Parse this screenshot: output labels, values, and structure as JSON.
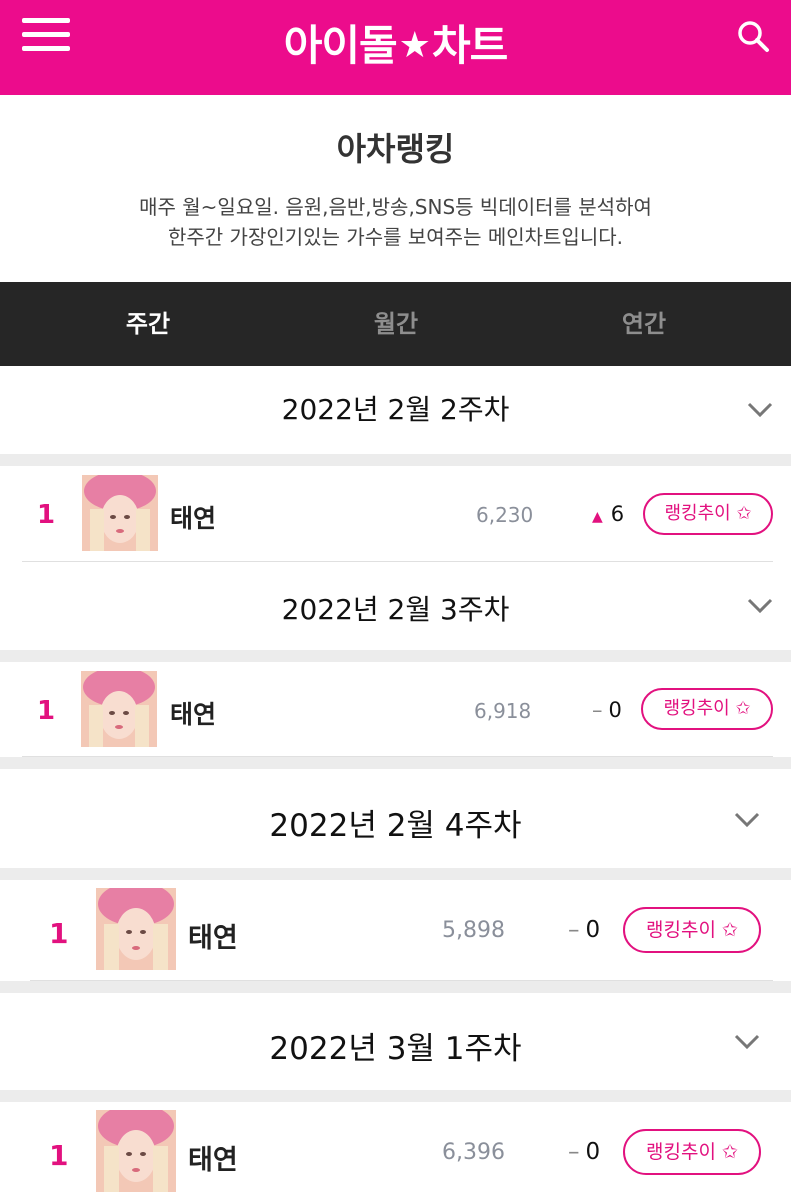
{
  "header": {
    "logo_left": "아이돌",
    "logo_star": "★",
    "logo_right": "차트",
    "menu_icon": "hamburger-menu-icon",
    "search_icon": "search-icon",
    "brand_color": "#ec0c8c"
  },
  "page": {
    "title": "아차랭킹",
    "desc_line1": "매주 월~일요일. 음원,음반,방송,SNS등 빅데이터를 분석하여",
    "desc_line2": "한주간 가장인기있는 가수를 보여주는 메인차트입니다."
  },
  "tabs": [
    {
      "label": "주간",
      "active": true
    },
    {
      "label": "월간",
      "active": false
    },
    {
      "label": "연간",
      "active": false
    }
  ],
  "weeks": [
    {
      "title": "2022년 2월 2주차",
      "rank": "1",
      "artist": "태연",
      "score": "6,230",
      "change_symbol": "▲",
      "change_value": "6",
      "trend_label": "랭킹추이 ✩"
    },
    {
      "title": "2022년 2월 3주차",
      "rank": "1",
      "artist": "태연",
      "score": "6,918",
      "change_symbol": "–",
      "change_value": "0",
      "trend_label": "랭킹추이 ✩"
    },
    {
      "title": "2022년 2월 4주차",
      "rank": "1",
      "artist": "태연",
      "score": "5,898",
      "change_symbol": "–",
      "change_value": "0",
      "trend_label": "랭킹추이 ✩"
    },
    {
      "title": "2022년 3월 1주차",
      "rank": "1",
      "artist": "태연",
      "score": "6,396",
      "change_symbol": "–",
      "change_value": "0",
      "trend_label": "랭킹추이 ✩"
    }
  ]
}
